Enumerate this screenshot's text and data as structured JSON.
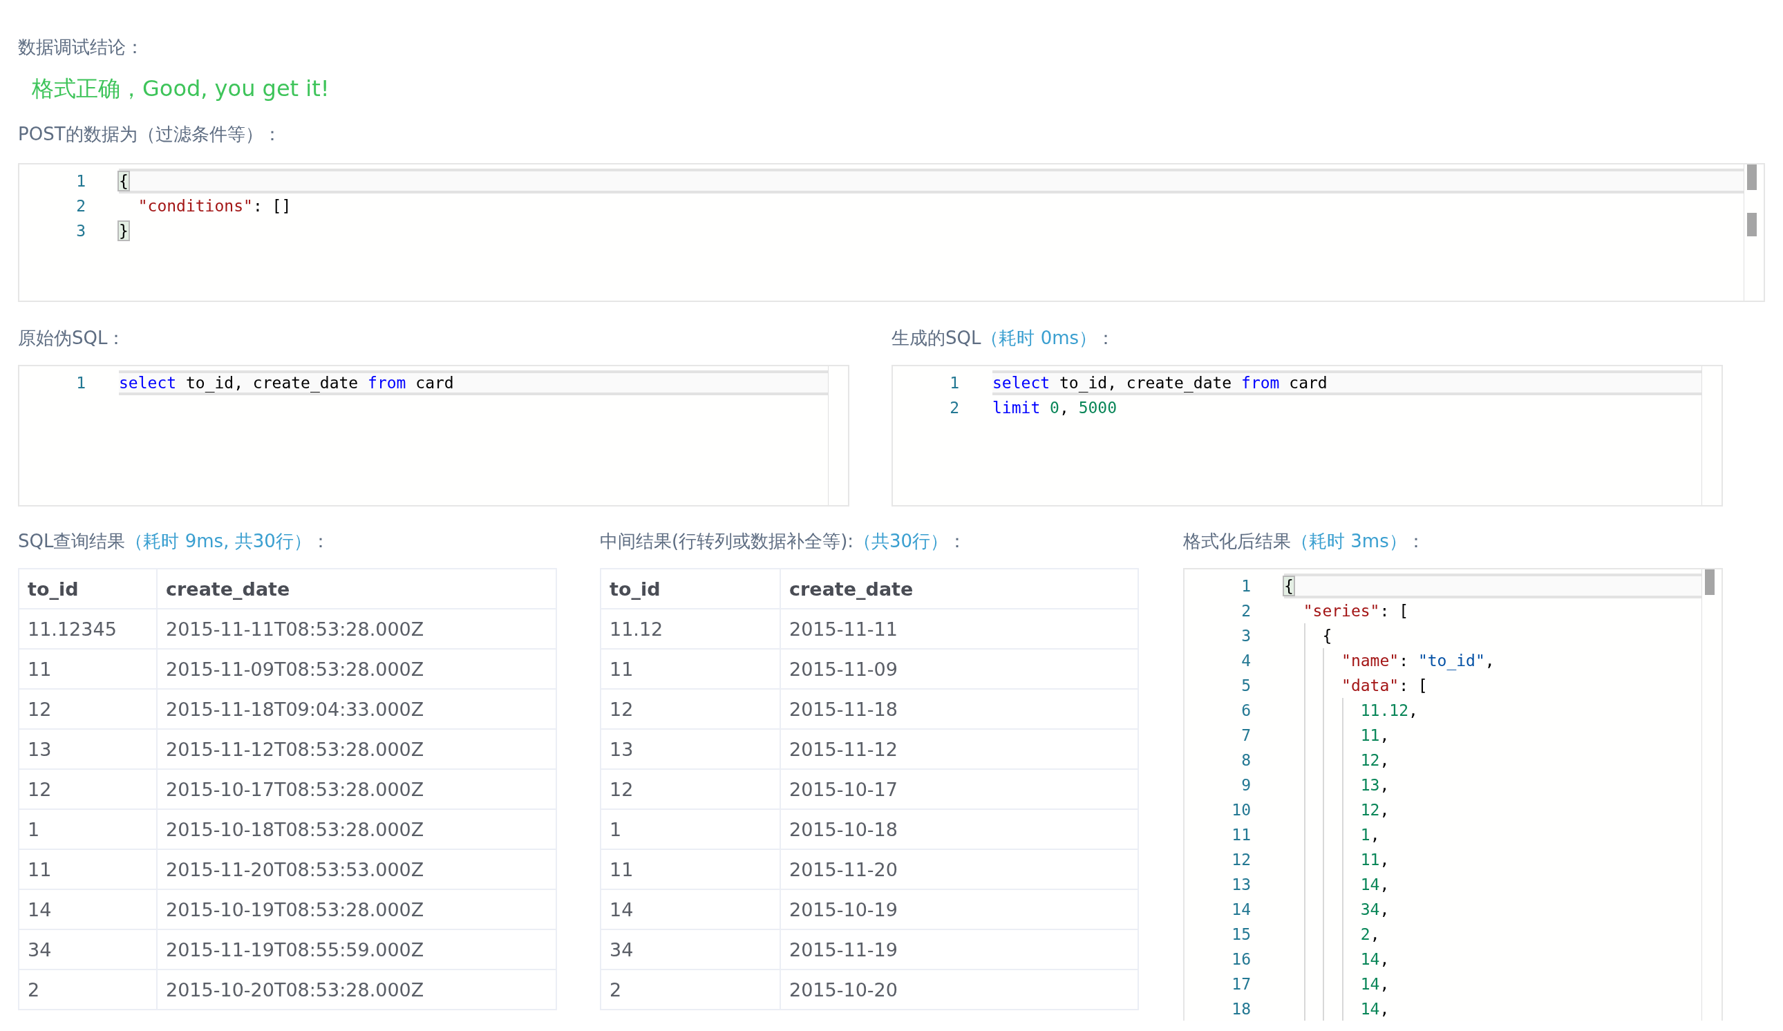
{
  "conclusion": {
    "label": {
      "text": "数据调试结论："
    },
    "message": "格式正确，Good, you get it!"
  },
  "post_data": {
    "label": {
      "text": "POST的数据为（过滤条件等）："
    },
    "lines": [
      {
        "number": "1",
        "current": true,
        "tokens": [
          {
            "kind": "bracket",
            "text": "{",
            "matched": true
          }
        ]
      },
      {
        "number": "2",
        "current": false,
        "tokens": [
          {
            "kind": "key",
            "text": "  \"conditions\""
          },
          {
            "kind": "plain",
            "text": ": []"
          }
        ]
      },
      {
        "number": "3",
        "current": false,
        "tokens": [
          {
            "kind": "bracket",
            "text": "}",
            "matched": true
          }
        ]
      }
    ]
  },
  "raw_sql": {
    "label": {
      "text": "原始伪SQL："
    },
    "lines": [
      {
        "number": "1",
        "current": true,
        "tokens": [
          {
            "kind": "keyword",
            "text": "select"
          },
          {
            "kind": "plain",
            "text": " to_id, create_date "
          },
          {
            "kind": "keyword",
            "text": "from"
          },
          {
            "kind": "plain",
            "text": " card"
          }
        ]
      }
    ]
  },
  "generated_sql": {
    "label": {
      "text": "生成的SQL",
      "note": "（耗时 0ms）",
      "suffix": "："
    },
    "lines": [
      {
        "number": "1",
        "current": true,
        "tokens": [
          {
            "kind": "keyword",
            "text": "select"
          },
          {
            "kind": "plain",
            "text": " to_id, create_date "
          },
          {
            "kind": "keyword",
            "text": "from"
          },
          {
            "kind": "plain",
            "text": " card"
          }
        ]
      },
      {
        "number": "2",
        "current": false,
        "tokens": [
          {
            "kind": "keyword",
            "text": "limit"
          },
          {
            "kind": "number",
            "text": " 0"
          },
          {
            "kind": "plain",
            "text": ", "
          },
          {
            "kind": "number",
            "text": "5000"
          }
        ]
      }
    ]
  },
  "query_result": {
    "label": {
      "text": "SQL查询结果",
      "note": "（耗时 9ms, 共30行）",
      "suffix": "："
    },
    "columns": [
      "to_id",
      "create_date"
    ],
    "rows": [
      [
        "11.12345",
        "2015-11-11T08:53:28.000Z"
      ],
      [
        "11",
        "2015-11-09T08:53:28.000Z"
      ],
      [
        "12",
        "2015-11-18T09:04:33.000Z"
      ],
      [
        "13",
        "2015-11-12T08:53:28.000Z"
      ],
      [
        "12",
        "2015-10-17T08:53:28.000Z"
      ],
      [
        "1",
        "2015-10-18T08:53:28.000Z"
      ],
      [
        "11",
        "2015-11-20T08:53:53.000Z"
      ],
      [
        "14",
        "2015-10-19T08:53:28.000Z"
      ],
      [
        "34",
        "2015-11-19T08:55:59.000Z"
      ],
      [
        "2",
        "2015-10-20T08:53:28.000Z"
      ]
    ]
  },
  "intermediate_result": {
    "label": {
      "text": "中间结果(行转列或数据补全等):",
      "note": "（共30行）",
      "suffix": "："
    },
    "columns": [
      "to_id",
      "create_date"
    ],
    "rows": [
      [
        "11.12",
        "2015-11-11"
      ],
      [
        "11",
        "2015-11-09"
      ],
      [
        "12",
        "2015-11-18"
      ],
      [
        "13",
        "2015-11-12"
      ],
      [
        "12",
        "2015-10-17"
      ],
      [
        "1",
        "2015-10-18"
      ],
      [
        "11",
        "2015-11-20"
      ],
      [
        "14",
        "2015-10-19"
      ],
      [
        "34",
        "2015-11-19"
      ],
      [
        "2",
        "2015-10-20"
      ]
    ]
  },
  "formatted_result": {
    "label": {
      "text": "格式化后结果",
      "note": "（耗时 3ms）",
      "suffix": "："
    },
    "lines": [
      {
        "number": "1",
        "current": true,
        "tokens": [
          {
            "kind": "bracket",
            "text": "{",
            "matched": true
          }
        ]
      },
      {
        "number": "2",
        "current": false,
        "tokens": [
          {
            "kind": "key",
            "text": "  \"series\""
          },
          {
            "kind": "plain",
            "text": ": ["
          }
        ]
      },
      {
        "number": "3",
        "current": false,
        "tokens": [
          {
            "kind": "plain",
            "text": "    {"
          }
        ]
      },
      {
        "number": "4",
        "current": false,
        "tokens": [
          {
            "kind": "key",
            "text": "      \"name\""
          },
          {
            "kind": "plain",
            "text": ": "
          },
          {
            "kind": "string",
            "text": "\"to_id\""
          },
          {
            "kind": "plain",
            "text": ","
          }
        ]
      },
      {
        "number": "5",
        "current": false,
        "tokens": [
          {
            "kind": "key",
            "text": "      \"data\""
          },
          {
            "kind": "plain",
            "text": ": ["
          }
        ]
      },
      {
        "number": "6",
        "current": false,
        "tokens": [
          {
            "kind": "number",
            "text": "        11.12"
          },
          {
            "kind": "plain",
            "text": ","
          }
        ]
      },
      {
        "number": "7",
        "current": false,
        "tokens": [
          {
            "kind": "number",
            "text": "        11"
          },
          {
            "kind": "plain",
            "text": ","
          }
        ]
      },
      {
        "number": "8",
        "current": false,
        "tokens": [
          {
            "kind": "number",
            "text": "        12"
          },
          {
            "kind": "plain",
            "text": ","
          }
        ]
      },
      {
        "number": "9",
        "current": false,
        "tokens": [
          {
            "kind": "number",
            "text": "        13"
          },
          {
            "kind": "plain",
            "text": ","
          }
        ]
      },
      {
        "number": "10",
        "current": false,
        "tokens": [
          {
            "kind": "number",
            "text": "        12"
          },
          {
            "kind": "plain",
            "text": ","
          }
        ]
      },
      {
        "number": "11",
        "current": false,
        "tokens": [
          {
            "kind": "number",
            "text": "        1"
          },
          {
            "kind": "plain",
            "text": ","
          }
        ]
      },
      {
        "number": "12",
        "current": false,
        "tokens": [
          {
            "kind": "number",
            "text": "        11"
          },
          {
            "kind": "plain",
            "text": ","
          }
        ]
      },
      {
        "number": "13",
        "current": false,
        "tokens": [
          {
            "kind": "number",
            "text": "        14"
          },
          {
            "kind": "plain",
            "text": ","
          }
        ]
      },
      {
        "number": "14",
        "current": false,
        "tokens": [
          {
            "kind": "number",
            "text": "        34"
          },
          {
            "kind": "plain",
            "text": ","
          }
        ]
      },
      {
        "number": "15",
        "current": false,
        "tokens": [
          {
            "kind": "number",
            "text": "        2"
          },
          {
            "kind": "plain",
            "text": ","
          }
        ]
      },
      {
        "number": "16",
        "current": false,
        "tokens": [
          {
            "kind": "number",
            "text": "        14"
          },
          {
            "kind": "plain",
            "text": ","
          }
        ]
      },
      {
        "number": "17",
        "current": false,
        "tokens": [
          {
            "kind": "number",
            "text": "        14"
          },
          {
            "kind": "plain",
            "text": ","
          }
        ]
      },
      {
        "number": "18",
        "current": false,
        "tokens": [
          {
            "kind": "number",
            "text": "        14"
          },
          {
            "kind": "plain",
            "text": ","
          }
        ]
      }
    ]
  }
}
